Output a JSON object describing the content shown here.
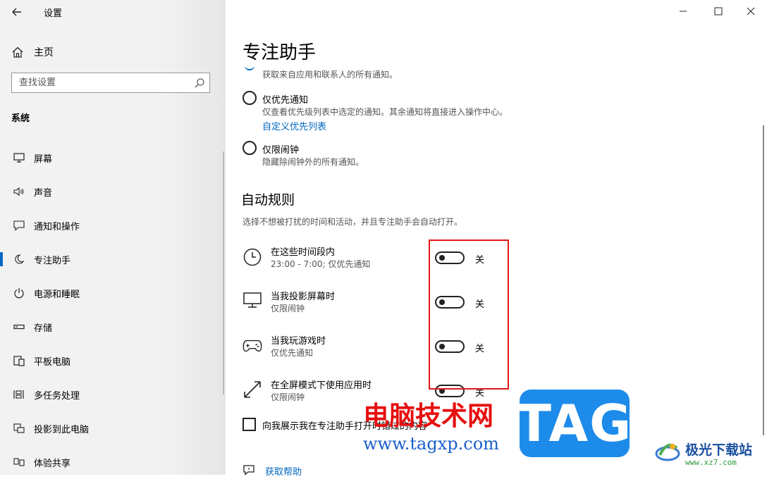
{
  "window": {
    "title": "设置"
  },
  "sidebar": {
    "home_label": "主页",
    "search_placeholder": "查找设置",
    "section_label": "系统",
    "items": [
      {
        "label": "屏幕",
        "icon": "monitor-icon"
      },
      {
        "label": "声音",
        "icon": "speaker-icon"
      },
      {
        "label": "通知和操作",
        "icon": "notification-icon"
      },
      {
        "label": "专注助手",
        "icon": "moon-icon",
        "active": true
      },
      {
        "label": "电源和睡眠",
        "icon": "power-icon"
      },
      {
        "label": "存储",
        "icon": "storage-icon"
      },
      {
        "label": "平板电脑",
        "icon": "tablet-icon"
      },
      {
        "label": "多任务处理",
        "icon": "multitask-icon"
      },
      {
        "label": "投影到此电脑",
        "icon": "project-icon"
      },
      {
        "label": "体验共享",
        "icon": "share-icon"
      }
    ]
  },
  "main": {
    "title": "专注助手",
    "clipped_desc": "获取来自应用和联系人的所有通知。",
    "options": [
      {
        "label": "仅优先通知",
        "desc": "仅查看优先级列表中选定的通知。其余通知将直接进入操作中心。",
        "link": "自定义优先列表"
      },
      {
        "label": "仅限闹钟",
        "desc": "隐藏除闹钟外的所有通知。"
      }
    ],
    "auto_rules": {
      "heading": "自动规则",
      "desc": "选择不想被打扰的时间和活动，并且专注助手会自动打开。",
      "rules": [
        {
          "title": "在这些时间段内",
          "sub": "23:00 - 7:00; 仅优先通知",
          "state": "关",
          "icon": "clock-icon"
        },
        {
          "title": "当我投影屏幕时",
          "sub": "仅限闹钟",
          "state": "关",
          "icon": "monitor-icon"
        },
        {
          "title": "当我玩游戏时",
          "sub": "仅优先通知",
          "state": "关",
          "icon": "gamepad-icon"
        },
        {
          "title": "在全屏模式下使用应用时",
          "sub": "仅限闹钟",
          "state": "关",
          "icon": "fullscreen-icon"
        }
      ]
    },
    "checkbox_label": "向我展示我在专注助手打开时错过的内容",
    "help_link": "获取帮助"
  },
  "watermark": {
    "red_text": "电脑技术网",
    "url": "www.tagxp.com",
    "tag": "TAG",
    "site_name": "极光下载站",
    "site_url": "www.xz7.com"
  }
}
